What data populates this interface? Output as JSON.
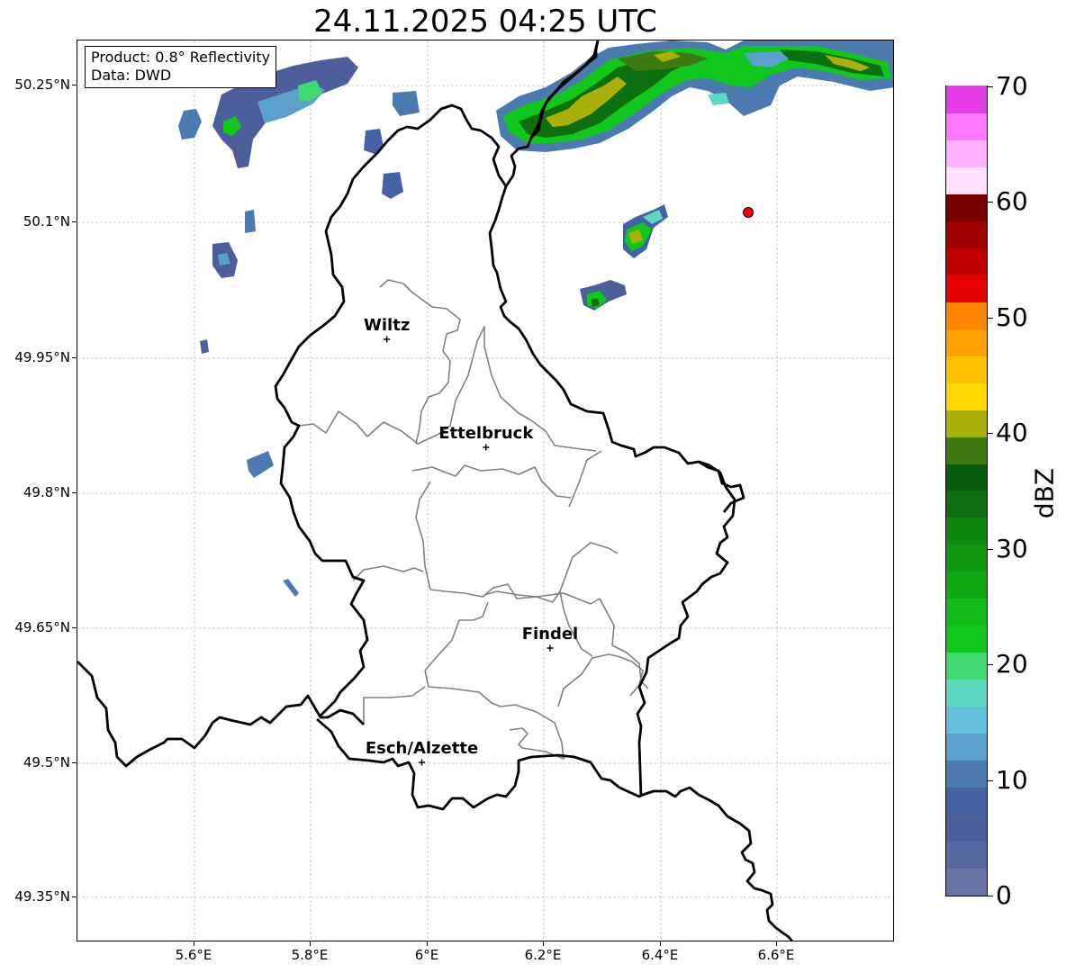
{
  "title": "24.11.2025 04:25 UTC",
  "info": {
    "product": "Product: 0.8° Reflectivity",
    "data": "Data: DWD"
  },
  "lat_ticks": [
    "50.25°N",
    "50.1°N",
    "49.95°N",
    "49.8°N",
    "49.65°N",
    "49.5°N",
    "49.35°N"
  ],
  "lon_ticks": [
    "5.6°E",
    "5.8°E",
    "6°E",
    "6.2°E",
    "6.4°E",
    "6.6°E"
  ],
  "cities": [
    {
      "name": "Wiltz",
      "lon": 5.93,
      "lat": 49.97
    },
    {
      "name": "Ettelbruck",
      "lon": 6.1,
      "lat": 49.85
    },
    {
      "name": "Findel",
      "lon": 6.21,
      "lat": 49.627
    },
    {
      "name": "Esch/Alzette",
      "lon": 5.99,
      "lat": 49.5
    }
  ],
  "marker": {
    "lon": 6.55,
    "lat": 50.111,
    "color": "#ff0000"
  },
  "colorbar": {
    "label": "dBZ",
    "min": 0,
    "max": 70,
    "tick_labels": [
      "0",
      "10",
      "20",
      "30",
      "40",
      "50",
      "60",
      "70"
    ],
    "colors": [
      "#6674a6",
      "#5668a0",
      "#4c5f9b",
      "#4562a4",
      "#4b7ab0",
      "#5aa0c8",
      "#64c0dc",
      "#5cd8c0",
      "#40d870",
      "#10c81c",
      "#10bc18",
      "#10a812",
      "#109810",
      "#0e880e",
      "#0c7010",
      "#085c10",
      "#3e7a10",
      "#aab008",
      "#ffd800",
      "#ffc000",
      "#ffa000",
      "#ff8400",
      "#e40000",
      "#c00000",
      "#a20000",
      "#7a0000",
      "#ffe0ff",
      "#ffb0ff",
      "#ff78ff",
      "#e83ce8"
    ]
  }
}
